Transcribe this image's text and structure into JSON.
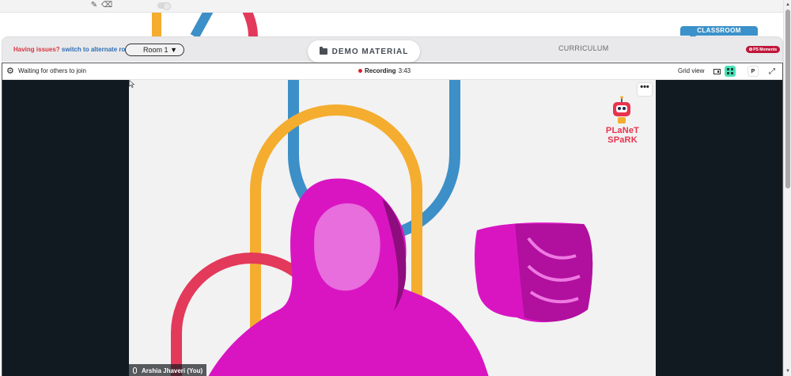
{
  "top_toolbar": {
    "pencil_icon": "pencil-icon",
    "eraser_icon": "eraser-icon"
  },
  "header": {
    "issues_text": "Having issues?",
    "alternate_room_link": "switch to alternate room",
    "room_select": {
      "value": "Room 1"
    },
    "demo_material_tab": "DEMO MATERIAL",
    "curriculum_tab": "CURRICULUM",
    "classroom_tab": "CLASSROOM",
    "ps_moments_badge": "PS Moments"
  },
  "call_toolbar": {
    "waiting_text": "Waiting for others to join",
    "recording_label": "Recording",
    "recording_time": "3:43",
    "view_label": "Grid view",
    "p_button": "P"
  },
  "video": {
    "participant_name": "Arshia Jhaveri (You)",
    "more_button": "•••",
    "brand_logo_line1": "PLaNeT",
    "brand_logo_line2": "SPaRK"
  },
  "colors": {
    "accent_blue": "#3b91c9",
    "recording_red": "#d8232f",
    "grid_active": "#4be0b8",
    "deco_yellow": "#f4ad2f",
    "deco_blue": "#3d8fc7",
    "deco_red": "#e3395a",
    "person_magenta": "#d915c2"
  }
}
